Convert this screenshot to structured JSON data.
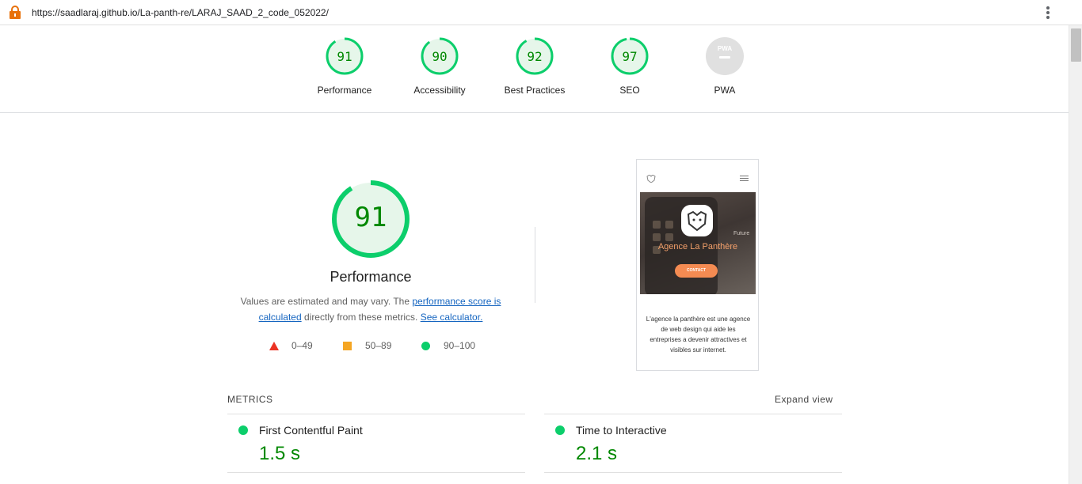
{
  "browser": {
    "url": "https://saadlaraj.github.io/La-panth-re/LARAJ_SAAD_2_code_052022/"
  },
  "colors": {
    "pass": "#0cce6b",
    "pass_text": "#008800",
    "average": "#f5a623",
    "fail": "#eb3323",
    "na": "#e0e0e0"
  },
  "categories": [
    {
      "label": "Performance",
      "score": "91",
      "fraction": 0.91
    },
    {
      "label": "Accessibility",
      "score": "90",
      "fraction": 0.9
    },
    {
      "label": "Best Practices",
      "score": "92",
      "fraction": 0.92
    },
    {
      "label": "SEO",
      "score": "97",
      "fraction": 0.97
    },
    {
      "label": "PWA",
      "badge": "PWA"
    }
  ],
  "performance": {
    "score": "91",
    "fraction": 0.91,
    "title": "Performance",
    "desc_pre": "Values are estimated and may vary. The ",
    "desc_link1": "performance score is calculated",
    "desc_mid": " directly from these metrics. ",
    "desc_link2": "See calculator."
  },
  "legend": [
    {
      "shape": "triangle",
      "range": "0–49"
    },
    {
      "shape": "square",
      "range": "50–89"
    },
    {
      "shape": "circle",
      "range": "90–100"
    }
  ],
  "screenshot": {
    "headline": "Agence La Panthère",
    "future_word": "Future",
    "cta": "CONTACT",
    "body": "L'agence la panthère est une agence de web design qui aide les entreprises a devenir attractives et visibles sur internet."
  },
  "metrics": {
    "section_label": "METRICS",
    "expand_label": "Expand view",
    "items": [
      {
        "name": "First Contentful Paint",
        "value": "1.5 s"
      },
      {
        "name": "Time to Interactive",
        "value": "2.1 s"
      }
    ]
  }
}
